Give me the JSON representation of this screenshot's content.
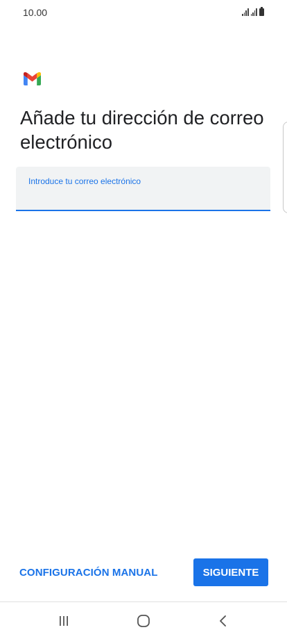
{
  "status_bar": {
    "time": "10.00"
  },
  "colors": {
    "accent": "#1a73e8",
    "field_background": "#f1f3f4",
    "title_text": "#202124"
  },
  "app": {
    "logo_icon": "gmail-logo-icon"
  },
  "page": {
    "title": "Añade tu dirección de correo electrónico"
  },
  "email_field": {
    "label": "Introduce tu correo electrónico",
    "value": "",
    "placeholder": ""
  },
  "actions": {
    "manual_setup_label": "CONFIGURACIÓN MANUAL",
    "next_label": "SIGUIENTE"
  },
  "navigation": {
    "recents_icon": "recents-icon",
    "home_icon": "home-icon",
    "back_icon": "back-icon"
  }
}
